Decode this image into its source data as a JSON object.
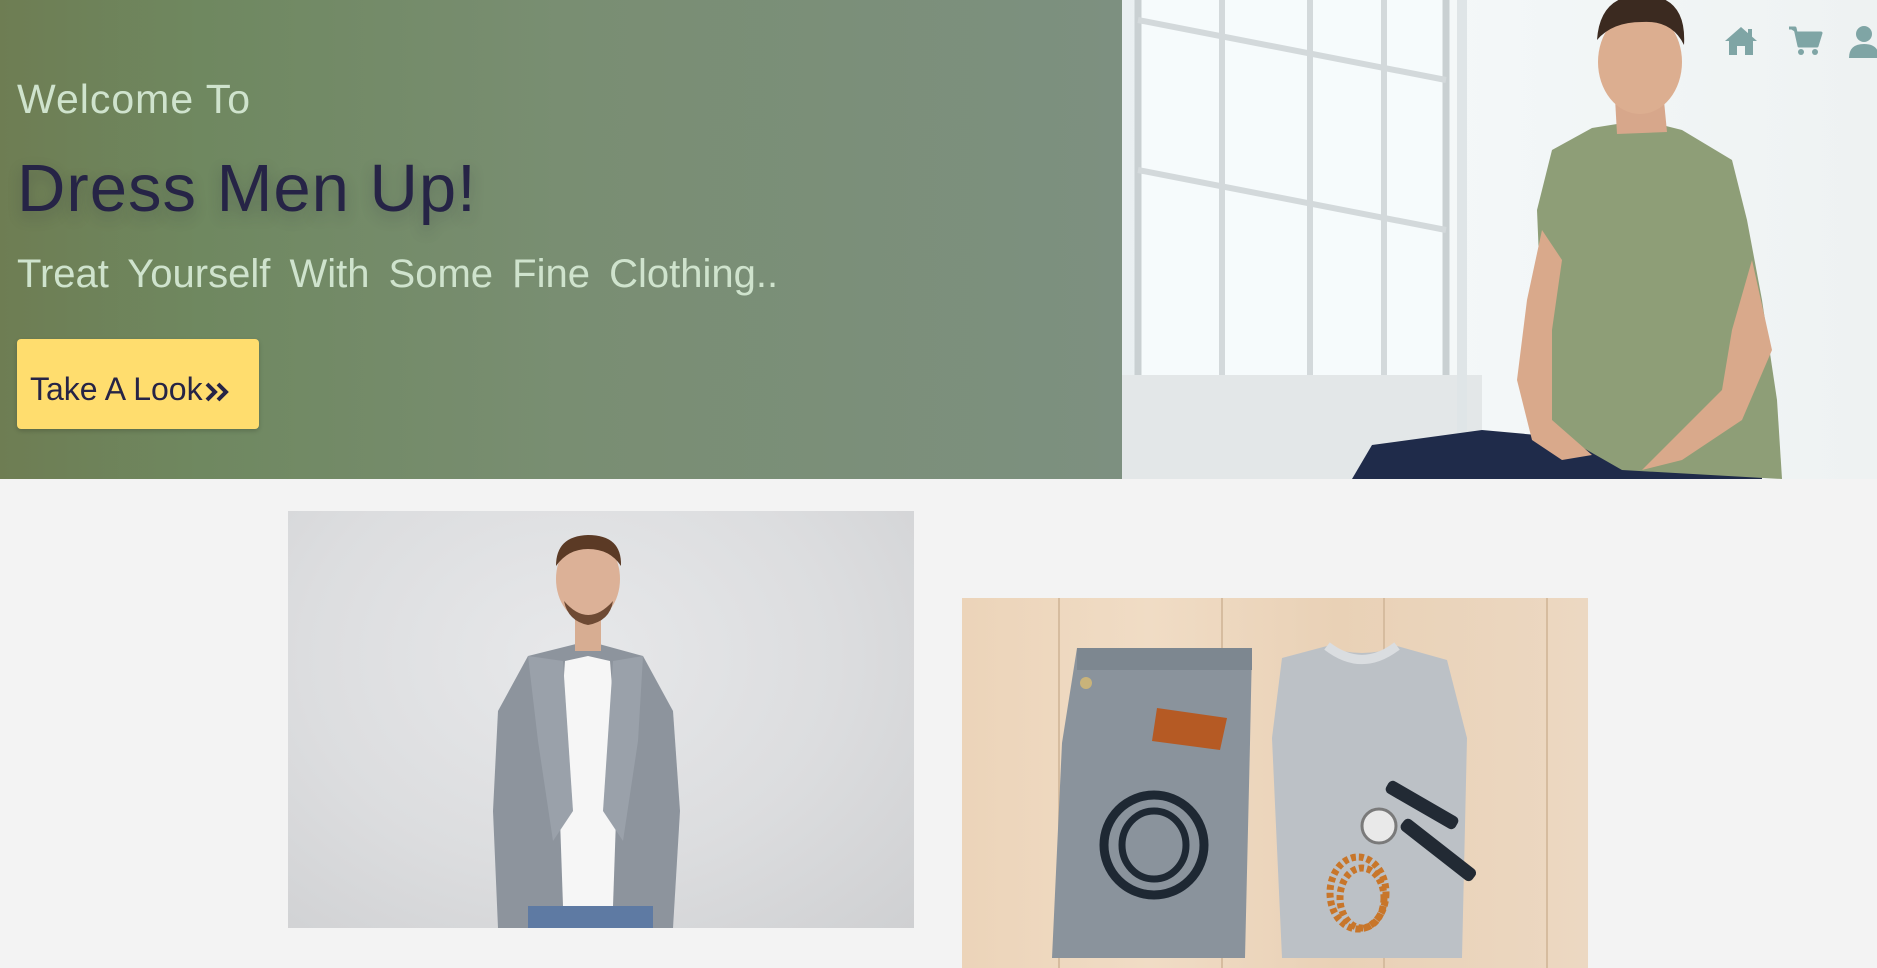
{
  "hero": {
    "welcome": "Welcome To",
    "brand": "Dress Men Up!",
    "tagline": "Treat Yourself With Some Fine Clothing..",
    "cta_label": "Take A Look"
  },
  "nav": {
    "icons": [
      "home-icon",
      "cart-icon",
      "user-icon"
    ]
  },
  "colors": {
    "hero_gradient_start": "#6e7d53",
    "hero_gradient_end": "#7d9080",
    "brand_text": "#262446",
    "light_text": "#cfe3cd",
    "cta_background": "#ffdd6e",
    "nav_icon": "#7fa5a5",
    "page_background": "#f3f3f3"
  }
}
